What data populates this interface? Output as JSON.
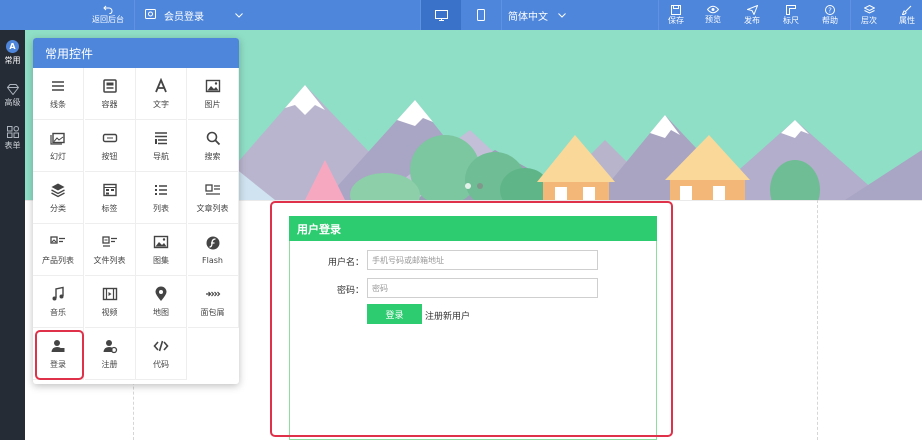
{
  "topbar": {
    "back_label": "返回后台",
    "page_selector": "会员登录",
    "language": "简体中文",
    "actions": [
      {
        "label": "保存",
        "icon": "save-icon"
      },
      {
        "label": "预览",
        "icon": "eye-icon"
      },
      {
        "label": "发布",
        "icon": "send-icon"
      },
      {
        "label": "标尺",
        "icon": "ruler-icon"
      },
      {
        "label": "帮助",
        "icon": "help-icon"
      },
      {
        "label": "层次",
        "icon": "layers-icon"
      },
      {
        "label": "属性",
        "icon": "brush-icon"
      }
    ]
  },
  "leftbar": {
    "items": [
      {
        "label": "常用",
        "badge": "A"
      },
      {
        "label": "高级"
      },
      {
        "label": "表单"
      }
    ]
  },
  "panel": {
    "title": "常用控件",
    "widgets": [
      {
        "label": "线条",
        "icon": "lines-icon"
      },
      {
        "label": "容器",
        "icon": "container-icon"
      },
      {
        "label": "文字",
        "icon": "text-icon"
      },
      {
        "label": "图片",
        "icon": "image-icon"
      },
      {
        "label": "幻灯",
        "icon": "slideshow-icon"
      },
      {
        "label": "按钮",
        "icon": "button-icon"
      },
      {
        "label": "导航",
        "icon": "navigation-icon"
      },
      {
        "label": "搜索",
        "icon": "search-icon"
      },
      {
        "label": "分类",
        "icon": "category-icon"
      },
      {
        "label": "标签",
        "icon": "tag-icon"
      },
      {
        "label": "列表",
        "icon": "list-icon"
      },
      {
        "label": "文章列表",
        "icon": "article-list-icon"
      },
      {
        "label": "产品列表",
        "icon": "product-list-icon"
      },
      {
        "label": "文件列表",
        "icon": "file-list-icon"
      },
      {
        "label": "图集",
        "icon": "gallery-icon"
      },
      {
        "label": "Flash",
        "icon": "flash-icon"
      },
      {
        "label": "音乐",
        "icon": "music-icon"
      },
      {
        "label": "视频",
        "icon": "video-icon"
      },
      {
        "label": "地图",
        "icon": "map-pin-icon"
      },
      {
        "label": "面包屑",
        "icon": "breadcrumb-icon"
      },
      {
        "label": "登录",
        "icon": "login-user-icon"
      },
      {
        "label": "注册",
        "icon": "register-user-icon"
      },
      {
        "label": "代码",
        "icon": "code-icon"
      }
    ]
  },
  "login_form": {
    "title": "用户登录",
    "username_label": "用户名：",
    "username_placeholder": "手机号码或邮箱地址",
    "password_label": "密码：",
    "password_placeholder": "密码",
    "submit_label": "登录",
    "register_link": "注册新用户"
  },
  "colors": {
    "topbar": "#4e86dc",
    "leftbar": "#262c35",
    "banner": "#8fdec6",
    "form_accent": "#2ecc71",
    "highlight": "#e0314a"
  }
}
